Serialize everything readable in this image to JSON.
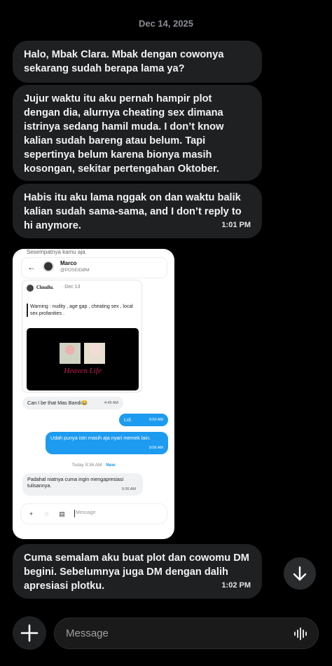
{
  "date_separator": "Dec 14, 2025",
  "messages": [
    {
      "text": "Halo, Mbak Clara. Mbak dengan cowonya sekarang sudah berapa lama ya?",
      "time": ""
    },
    {
      "text": "Jujur waktu itu aku pernah hampir plot dengan dia, alurnya cheating sex dimana istrinya sedang hamil muda. I don’t know kalian sudah bareng atau belum. Tapi sepertinya belum karena bionya masih kosongan, sekitar pertengahan Oktober.",
      "time": ""
    },
    {
      "text": "Habis itu aku lama nggak on dan waktu balik kalian sudah sama-sama, and I don’t reply to hi anymore.",
      "time": "1:01 PM"
    },
    {
      "text": "Cuma semalam aku buat plot dan cowomu DM begini. Sebelumnya juga DM dengan dalih apresiasi plotku.",
      "time": "1:02 PM"
    }
  ],
  "screenshot": {
    "top_cut_text": "Sesempatnya kamu aja.",
    "header": {
      "name": "Marco",
      "handle": "@POSEIDØM"
    },
    "tweet": {
      "author": "Claudia.",
      "date": "· Dec 13",
      "warning": "Warning : nudity , age gap , cheating sex , local sex profanities .",
      "image_text": "Heaven Life"
    },
    "dm": [
      {
        "text": "Can I be that Mas Bandi😂",
        "time": "4:49 AM"
      },
      {
        "text": "Lol.",
        "time": "9:00 AM"
      },
      {
        "text": "Udah punya istri masih aja nyari memek lain.",
        "time": "9:06 AM"
      }
    ],
    "today_label": "Today",
    "today_time": "9:36 AM",
    "new_label": "New",
    "dm_after": {
      "text": "Padahal niatnya cuma ingin mengapresiasi tulisannya.",
      "time": "9:36 AM"
    },
    "compose_placeholder": "Message"
  },
  "input": {
    "placeholder": "Message"
  },
  "icons": {
    "scroll_down": "arrow-down-icon",
    "plus": "plus-icon",
    "voice": "voice-wave-icon"
  },
  "colors": {
    "background": "#000000",
    "bubble": "#1f2022",
    "dm_blue": "#1d9bf0"
  }
}
